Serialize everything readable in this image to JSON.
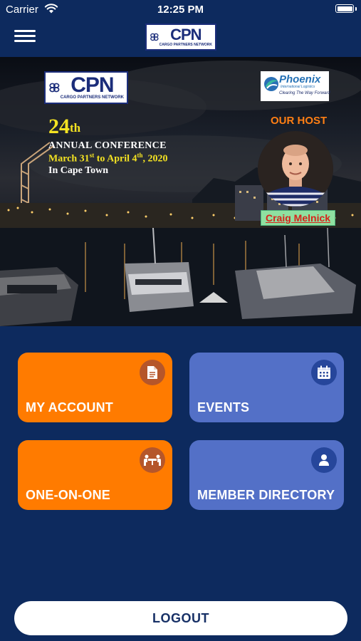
{
  "status_bar": {
    "carrier": "Carrier",
    "time": "12:25 PM"
  },
  "nav": {
    "menu_icon": "hamburger-menu-icon",
    "logo": {
      "main": "CPN",
      "sub": "CARGO PARTNERS NETWORK"
    }
  },
  "banner": {
    "logo": {
      "main": "CPN",
      "sub": "CARGO PARTNERS NETWORK"
    },
    "conference": {
      "number": "24",
      "number_suffix": "th",
      "title": "ANNUAL CONFERENCE",
      "date_start_day": "March 31",
      "date_start_suffix": "st",
      "date_to": " to April 4",
      "date_end_suffix": "th",
      "date_year": ", 2020",
      "place": "In Cape Town"
    },
    "sponsor": {
      "name": "Phoenix",
      "subtitle": "International Logistics",
      "tagline": "Clearing The Way Forward"
    },
    "host_label": "OUR HOST",
    "host_name": "Craig Melnick"
  },
  "tiles": [
    {
      "label": "MY ACCOUNT",
      "icon": "document-icon",
      "color": "#ff7b00"
    },
    {
      "label": "EVENTS",
      "icon": "calendar-icon",
      "color": "#5370c7"
    },
    {
      "label": "ONE-ON-ONE",
      "icon": "meeting-icon",
      "color": "#ff7b00"
    },
    {
      "label": "MEMBER DIRECTORY",
      "icon": "person-icon",
      "color": "#5370c7"
    }
  ],
  "logout_label": "LOGOUT",
  "colors": {
    "background": "#0d2a5e",
    "orange": "#ff7b00",
    "blue": "#5370c7",
    "conference_yellow": "#f4e322",
    "host_orange": "#ff7f14"
  }
}
